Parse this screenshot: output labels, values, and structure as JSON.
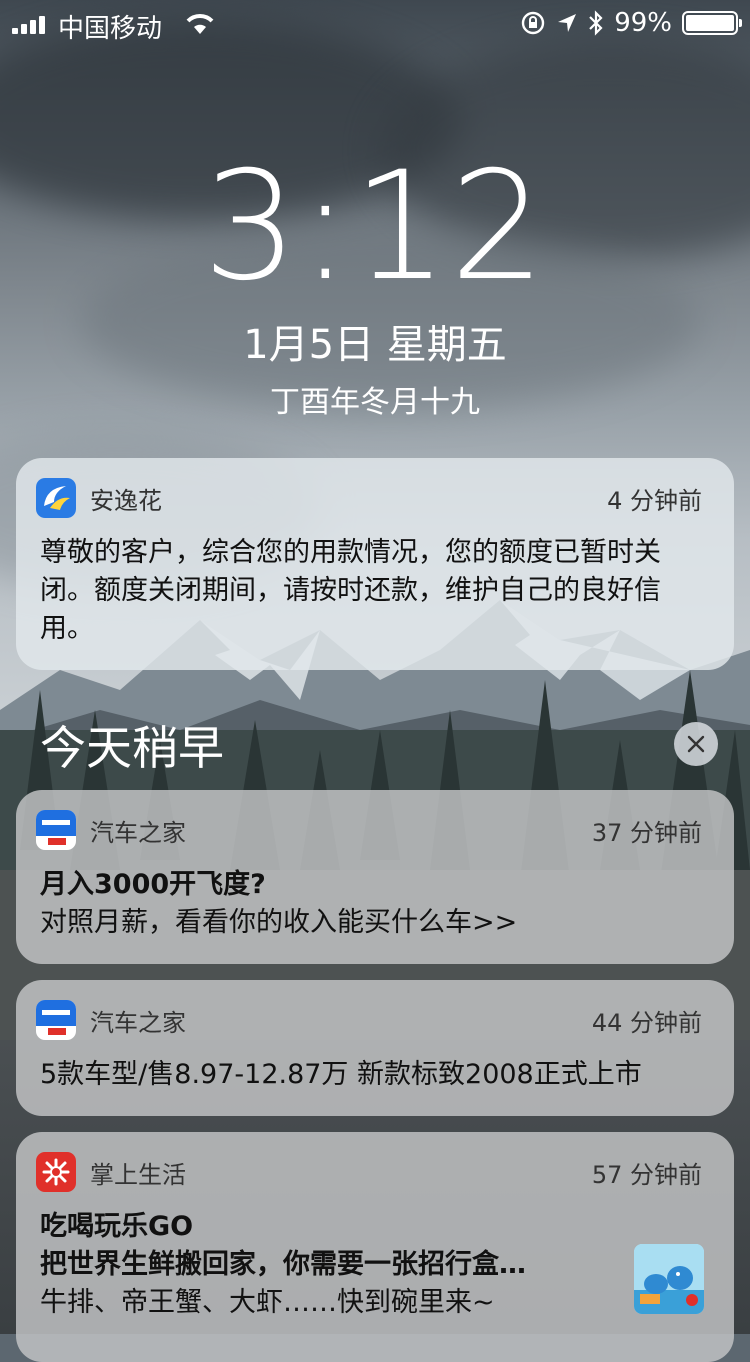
{
  "status_bar": {
    "carrier": "中国移动",
    "battery_percent": "99%",
    "battery_level": 0.99,
    "icons": [
      "signal-icon",
      "wifi-icon",
      "orientation-lock-icon",
      "location-icon",
      "bluetooth-icon",
      "battery-icon"
    ]
  },
  "lockscreen": {
    "time": "3:12",
    "date": "1月5日 星期五",
    "lunar_date": "丁酉年冬月十九"
  },
  "notifications": [
    {
      "app": "安逸花",
      "time": "4 分钟前",
      "text": "尊敬的客户，综合您的用款情况，您的额度已暂时关闭。额度关闭期间，请按时还款，维护自己的良好信用。",
      "icon": "anyihua-app-icon",
      "icon_color": "#2a7be4"
    }
  ],
  "earlier": {
    "section_title": "今天稍早",
    "clear_icon": "close-icon",
    "notifications": [
      {
        "app": "汽车之家",
        "time": "37 分钟前",
        "title": "月入3000开飞度?",
        "text": "对照月薪，看看你的收入能买什么车>>",
        "icon": "autohome-app-icon",
        "icon_color": "#1f6fe0"
      },
      {
        "app": "汽车之家",
        "time": "44 分钟前",
        "text": "5款车型/售8.97-12.87万 新款标致2008正式上市",
        "icon": "autohome-app-icon",
        "icon_color": "#1f6fe0"
      },
      {
        "app": "掌上生活",
        "time": "57 分钟前",
        "title": "吃喝玩乐GO",
        "subtitle": "把世界生鲜搬回家，你需要一张招行盒…",
        "text": "牛排、帝王蟹、大虾……快到碗里来~",
        "icon": "zhangshangshenghuo-app-icon",
        "icon_color": "#e0302a",
        "thumbnail": "thumbnail-image"
      }
    ]
  }
}
